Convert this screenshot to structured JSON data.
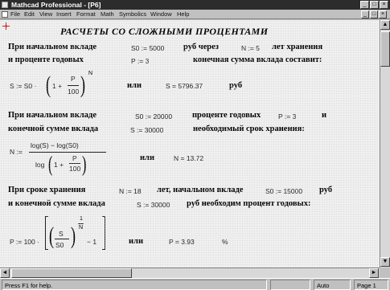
{
  "window": {
    "title": "Mathcad Professional - [P6]",
    "minimize_glyph": "_",
    "maximize_glyph": "□",
    "close_glyph": "×"
  },
  "menu": {
    "items": [
      "File",
      "Edit",
      "View",
      "Insert",
      "Format",
      "Math",
      "Symbolics",
      "Window",
      "Help"
    ]
  },
  "worksheet": {
    "title": "РАСЧЕТЫ СО СЛОЖНЫМИ ПРОЦЕНТАМИ",
    "block1": {
      "l1_a": "При начальном вкладе",
      "s0_def": "S0 := 5000",
      "l1_b": "руб через",
      "n_def": "N := 5",
      "l1_c": "лет хранения",
      "l2_a": "и проценте годовых",
      "p_def": "P := 3",
      "l2_b": "конечная сумма вклада составит:",
      "f_lhs": "S := S0 ·",
      "f_one": "1 +",
      "f_p": "P",
      "f_100": "100",
      "f_exp": "N",
      "or_label": "или",
      "result": "S = 5796.37",
      "unit": "руб"
    },
    "block2": {
      "l1_a": "При начальном вкладе",
      "s0_def": "S0 := 20000",
      "l1_b": "проценте годовых",
      "p_def": "P := 3",
      "l1_c": "и",
      "l2_a": "конечной сумме вклада",
      "s_def": "S := 30000",
      "l2_b": "необходимый срок хранения:",
      "f_lhs": "N :=",
      "f_num": "log(S) − log(S0)",
      "f_den_a": "log",
      "f_one": "1 +",
      "f_p": "P",
      "f_100": "100",
      "or_label": "или",
      "result": "N = 13.72"
    },
    "block3": {
      "l1_a": "При сроке хранения",
      "n_def": "N := 18",
      "l1_b": "лет, начальном вкладе",
      "s0_def": "S0 := 15000",
      "l1_c": "руб",
      "l2_a": "и конечной сумме вклада",
      "s_def": "S := 30000",
      "l2_b": "руб необходим процент годовых:",
      "f_lhs": "P := 100 ·",
      "f_s": "S",
      "f_s0": "S0",
      "f_one": "1",
      "f_n": "N",
      "f_minus1": "− 1",
      "or_label": "или",
      "result": "P = 3.93",
      "unit": "%"
    }
  },
  "scrollbar": {
    "up_glyph": "▲",
    "down_glyph": "▼",
    "left_glyph": "◄",
    "right_glyph": "►"
  },
  "status": {
    "help": "Press F1 for help.",
    "mode": "Auto",
    "page": "Page 1"
  }
}
